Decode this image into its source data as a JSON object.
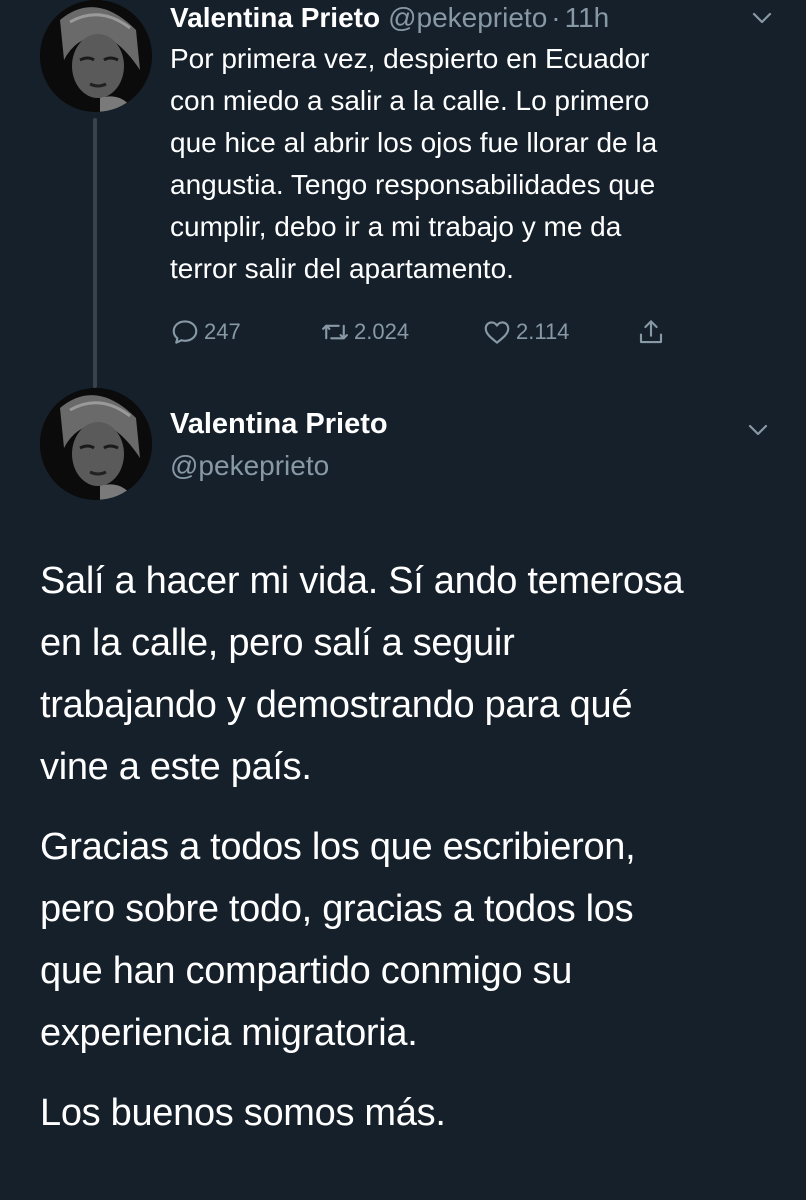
{
  "tweets": [
    {
      "author_name": "Valentina Prieto",
      "handle": "@pekeprieto",
      "separator": "·",
      "time": "11h",
      "text_lines": [
        "Por primera vez, despierto en Ecuador",
        "con miedo a salir a la calle. Lo primero",
        "que hice al abrir los ojos fue llorar de la",
        "angustia. Tengo responsabilidades que",
        "cumplir, debo ir a mi trabajo y me da",
        "terror salir del apartamento."
      ],
      "stats": {
        "replies": "247",
        "retweets": "2.024",
        "likes": "2.114"
      },
      "icons": [
        "reply-icon",
        "retweet-icon",
        "like-icon",
        "share-icon",
        "chevron-down-icon"
      ]
    },
    {
      "author_name": "Valentina Prieto",
      "handle": "@pekeprieto",
      "paragraphs": [
        [
          "Salí a hacer mi vida. Sí ando temerosa",
          "en la calle, pero salí a seguir",
          "trabajando y demostrando para qué",
          "vine a este país."
        ],
        [
          "Gracias a todos los que escribieron,",
          "pero sobre todo, gracias a todos los",
          "que han compartido conmigo su",
          "experiencia migratoria."
        ],
        [
          "Los buenos somos más."
        ]
      ]
    }
  ],
  "colors": {
    "background": "#15202b",
    "text_primary": "#ffffff",
    "text_secondary": "#8899a6",
    "thread_line": "#38444d"
  }
}
